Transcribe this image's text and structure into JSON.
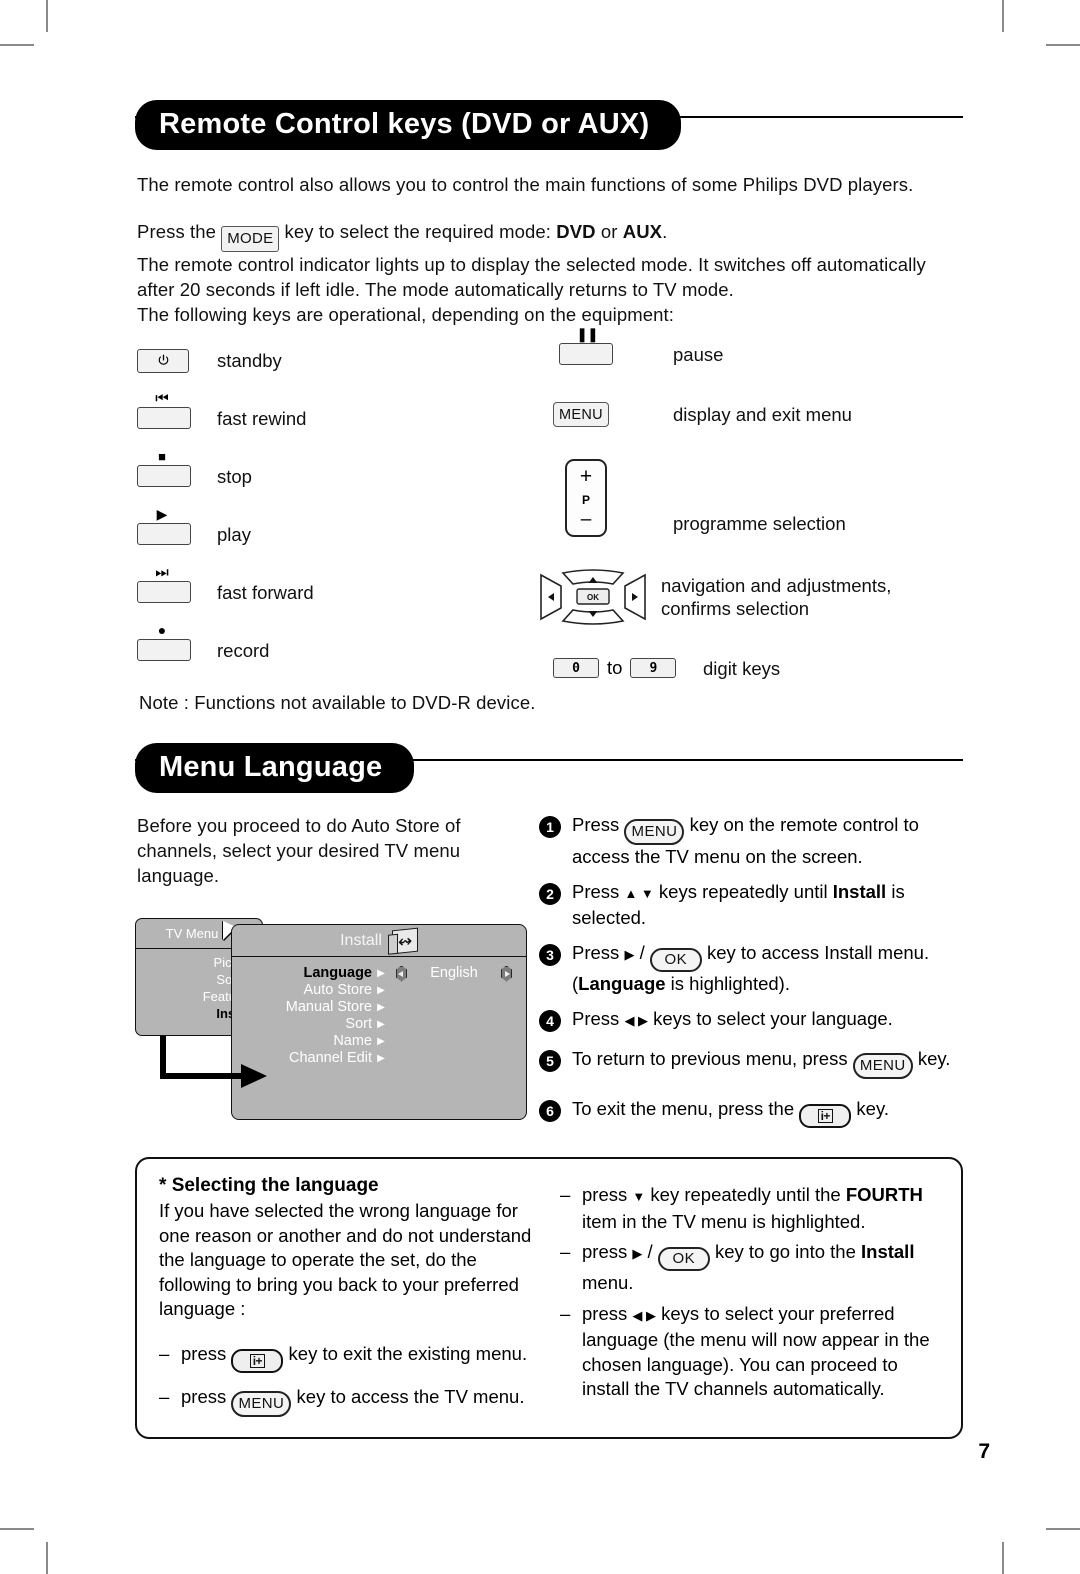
{
  "page": {
    "number": "7"
  },
  "section1": {
    "title": "Remote Control keys (DVD or AUX)",
    "intro": "The remote control also allows you to control the main functions of some Philips DVD players.",
    "press_prefix": "Press the",
    "mode_key": "MODE",
    "press_suffix_a": "key to select the required mode: ",
    "mode_dvd": "DVD",
    "mode_or": " or ",
    "mode_aux": "AUX",
    "mode_period": ".",
    "line2": "The remote control indicator lights up to display the selected mode. It switches off automatically",
    "line3": "after 20 seconds if left idle. The mode automatically returns to TV mode.",
    "line4": "The following keys are operational, depending on the equipment:",
    "note": "Note : Functions not available to DVD-R device.",
    "keys_left": [
      {
        "glyph": "power-icon",
        "label": "standby"
      },
      {
        "glyph": "fast-rewind-icon",
        "label": "fast rewind"
      },
      {
        "glyph": "stop-icon",
        "label": "stop"
      },
      {
        "glyph": "play-icon",
        "label": "play"
      },
      {
        "glyph": "fast-forward-icon",
        "label": "fast forward"
      },
      {
        "glyph": "record-icon",
        "label": "record"
      }
    ],
    "keys_right": [
      {
        "glyph": "pause-icon",
        "label": "pause"
      },
      {
        "glyph": "menu-key",
        "label": "display and exit menu",
        "key_text": "MENU"
      },
      {
        "glyph": "programme-rocker",
        "label": "programme selection",
        "plus": "+",
        "p": "P",
        "minus": "–"
      },
      {
        "glyph": "navigation-pad",
        "label": "navigation and adjustments,",
        "label2": "confirms selection",
        "ok_text": "OK"
      },
      {
        "glyph": "digit-keys",
        "label": "digit keys",
        "digit_from": "0",
        "digit_to": "9",
        "between": "to"
      }
    ]
  },
  "section2": {
    "title": "Menu Language",
    "intro_line1": "Before you proceed to do Auto Store of",
    "intro_line2": "channels, select your desired TV menu language.",
    "tv_menu": {
      "header": "TV Menu",
      "left_items": [
        "Picture",
        "Sound",
        "Features",
        "Install"
      ],
      "selected_left_item": "Install",
      "right_header": "Install",
      "right_items": [
        "Language",
        "Auto Store",
        "Manual Store",
        "Sort",
        "Name",
        "Channel Edit"
      ],
      "highlighted_right_item": "Language",
      "value": "English"
    },
    "steps": [
      {
        "num": "1",
        "parts": [
          {
            "t": "text",
            "v": "Press "
          },
          {
            "t": "key-menu",
            "v": "MENU"
          },
          {
            "t": "text",
            "v": " key on the remote control to access the TV menu on the screen."
          }
        ]
      },
      {
        "num": "2",
        "parts": [
          {
            "t": "text",
            "v": "Press "
          },
          {
            "t": "glyph",
            "v": "▲ ▼"
          },
          {
            "t": "text",
            "v": " keys repeatedly until "
          },
          {
            "t": "bold",
            "v": "Install"
          },
          {
            "t": "text",
            "v": " is selected."
          }
        ]
      },
      {
        "num": "3",
        "parts": [
          {
            "t": "text",
            "v": "Press "
          },
          {
            "t": "glyph",
            "v": "▶"
          },
          {
            "t": "text",
            "v": " / "
          },
          {
            "t": "key-ok",
            "v": "OK"
          },
          {
            "t": "text",
            "v": " key to access Install menu. ("
          },
          {
            "t": "bold",
            "v": "Language"
          },
          {
            "t": "text",
            "v": " is highlighted)."
          }
        ]
      },
      {
        "num": "4",
        "parts": [
          {
            "t": "text",
            "v": "Press "
          },
          {
            "t": "glyph",
            "v": "◀ ▶"
          },
          {
            "t": "text",
            "v": " keys to select your language."
          }
        ]
      },
      {
        "num": "5",
        "parts": [
          {
            "t": "text",
            "v": "To return to previous menu, press "
          },
          {
            "t": "key-menu",
            "v": "MENU"
          },
          {
            "t": "text",
            "v": " key."
          }
        ]
      },
      {
        "num": "6",
        "parts": [
          {
            "t": "text",
            "v": "To exit the menu, press the "
          },
          {
            "t": "key-info",
            "v": "i+"
          },
          {
            "t": "text",
            "v": " key."
          }
        ]
      }
    ]
  },
  "panel": {
    "heading_marker": "*",
    "heading": "Selecting the language",
    "body": "If you have selected the wrong language for one reason or another and do not understand the language to operate the set, do the following to bring you back to your preferred language :",
    "left_bullets": [
      {
        "dash": "–",
        "parts": [
          {
            "t": "text",
            "v": "press "
          },
          {
            "t": "key-info",
            "v": "i+"
          },
          {
            "t": "text",
            "v": " key to exit the existing menu."
          }
        ]
      },
      {
        "dash": "–",
        "parts": [
          {
            "t": "text",
            "v": "press "
          },
          {
            "t": "key-menu",
            "v": "MENU"
          },
          {
            "t": "text",
            "v": " key to access the TV menu."
          }
        ]
      }
    ],
    "right_bullets": [
      {
        "dash": "–",
        "parts": [
          {
            "t": "text",
            "v": "press "
          },
          {
            "t": "glyph",
            "v": "▼"
          },
          {
            "t": "text",
            "v": " key repeatedly until the "
          },
          {
            "t": "bold",
            "v": "FOURTH"
          },
          {
            "t": "text",
            "v": " item in the TV menu is highlighted."
          }
        ]
      },
      {
        "dash": "–",
        "parts": [
          {
            "t": "text",
            "v": "press "
          },
          {
            "t": "glyph",
            "v": "▶"
          },
          {
            "t": "text",
            "v": " / "
          },
          {
            "t": "key-ok",
            "v": "OK"
          },
          {
            "t": "text",
            "v": " key to go into the "
          },
          {
            "t": "bold",
            "v": "Install"
          },
          {
            "t": "text",
            "v": " menu."
          }
        ]
      },
      {
        "dash": "–",
        "parts": [
          {
            "t": "text",
            "v": "press "
          },
          {
            "t": "glyph",
            "v": "◀ ▶"
          },
          {
            "t": "text",
            "v": " keys to select your preferred language (the menu will now appear in the chosen language). You can proceed to install the TV channels automatically."
          }
        ]
      }
    ]
  },
  "colors": {
    "banner_bg": "#000000",
    "banner_text": "#ffffff",
    "menu_panel": "#b5b5b5",
    "key_face": "#f2f2f2",
    "crop_mark": "#8a8a8a"
  }
}
